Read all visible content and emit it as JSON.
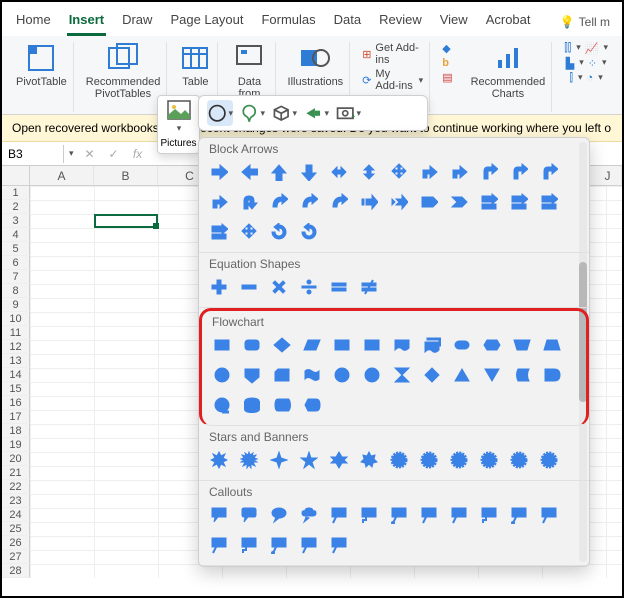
{
  "tabs": [
    "Home",
    "Insert",
    "Draw",
    "Page Layout",
    "Formulas",
    "Data",
    "Review",
    "View",
    "Acrobat"
  ],
  "active_tab": 1,
  "tellme": "Tell m",
  "ribbon": {
    "pivot": "PivotTable",
    "recpivot": "Recommended\nPivotTables",
    "table": "Table",
    "datapic": "Data from\nPicture",
    "illus": "Illustrations",
    "getaddins": "Get Add-ins",
    "myaddins": "My Add-ins",
    "recchart": "Recommended\nCharts"
  },
  "msgbar": "Open recovered workbooks? Your recent changes were saved. Do you want to continue working where you left o",
  "namebox": "B3",
  "columns": [
    "A",
    "B",
    "C"
  ],
  "last_col": "J",
  "rows_visible": 28,
  "selection": {
    "col": 1,
    "row": 2
  },
  "pictures_label": "Pictures",
  "shapes": {
    "block_arrows": {
      "title": "Block Arrows",
      "count": 28
    },
    "equation": {
      "title": "Equation Shapes",
      "count": 6
    },
    "flowchart": {
      "title": "Flowchart",
      "count": 28
    },
    "stars": {
      "title": "Stars and Banners",
      "count": 12
    },
    "callouts": {
      "title": "Callouts",
      "count": 17
    }
  }
}
